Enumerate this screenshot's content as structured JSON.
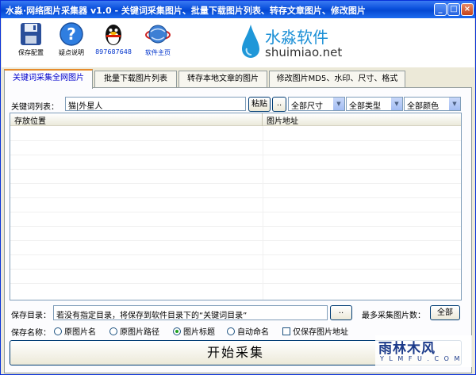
{
  "window": {
    "title": "水淼·网络图片采集器 v1.0 - 关键词采集图片、批量下载图片列表、转存文章图片、修改图片"
  },
  "toolbar": {
    "save_config": "保存配置",
    "help": "疑点说明",
    "qq": "897687648",
    "homepage": "软件主页"
  },
  "logo": {
    "cn": "水淼软件",
    "en": "shuimiao.net"
  },
  "tabs": [
    {
      "label": "关键词采集全网图片",
      "active": true
    },
    {
      "label": "批量下载图片列表",
      "active": false
    },
    {
      "label": "转存本地文章的图片",
      "active": false
    },
    {
      "label": "修改图片MD5、水印、尺寸、格式",
      "active": false
    }
  ],
  "keyword": {
    "label": "关键词列表：",
    "value": "猫|外星人",
    "paste_label": "粘贴",
    "dots_label": ".."
  },
  "filters": {
    "size": "全部尺寸",
    "type": "全部类型",
    "color": "全部颜色"
  },
  "table": {
    "columns": [
      "存放位置",
      "图片地址"
    ]
  },
  "save_dir": {
    "label": "保存目录：",
    "value": "若没有指定目录，将保存到软件目录下的“关键词目录”",
    "browse_label": "..",
    "max_label": "最多采集图片数：",
    "max_value": "全部"
  },
  "save_name": {
    "label": "保存名称：",
    "options": [
      {
        "label": "原图片名",
        "selected": false
      },
      {
        "label": "原图片路径",
        "selected": false
      },
      {
        "label": "图片标题",
        "selected": true
      },
      {
        "label": "自动命名",
        "selected": false
      }
    ],
    "only_url_label": "仅保存图片地址"
  },
  "start_label": "开始采集",
  "watermark": {
    "big": "雨林木风",
    "small": "Y L M F U . C O M"
  },
  "colors": {
    "title_blue": "#0a50dc",
    "tab_accent": "#e68b2c",
    "logo_blue": "#1a8fd6"
  }
}
